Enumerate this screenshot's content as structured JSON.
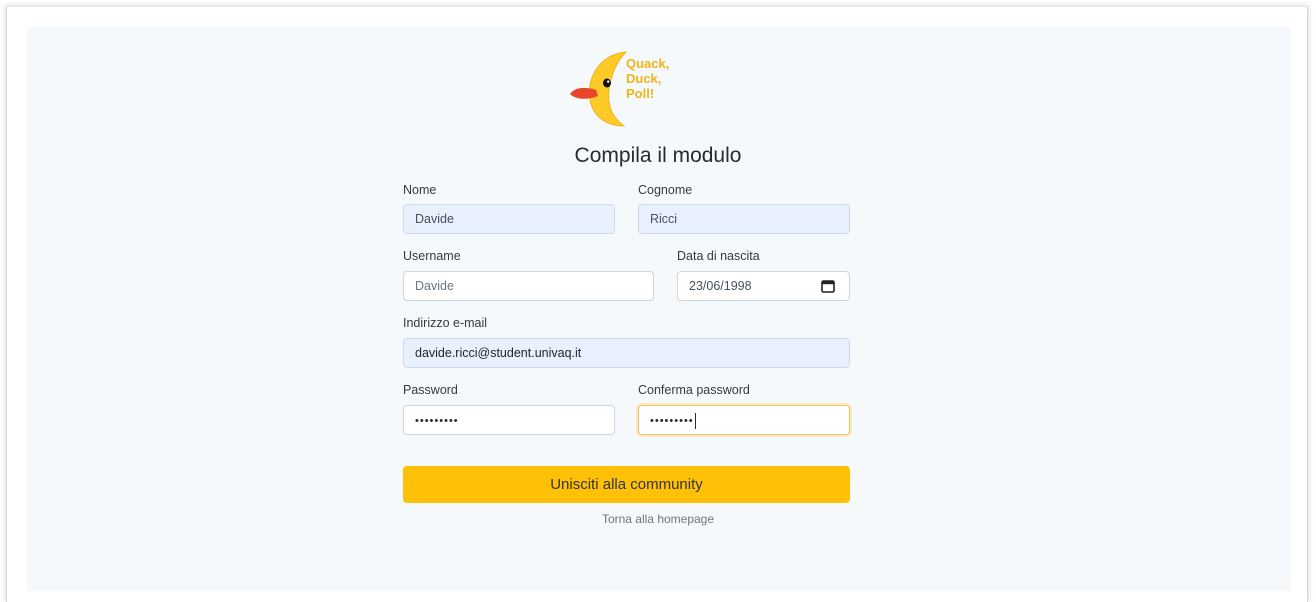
{
  "logo": {
    "line1": "Quack,",
    "line2": "Duck,",
    "line3": "Poll!",
    "colors": {
      "text": "#f0b419",
      "duck_body": "#ffc928",
      "beak": "#e8452c"
    }
  },
  "form": {
    "title": "Compila il modulo",
    "nome": {
      "label": "Nome",
      "value": "Davide"
    },
    "cognome": {
      "label": "Cognome",
      "value": "Ricci"
    },
    "username": {
      "label": "Username",
      "value": "Davide"
    },
    "data_nascita": {
      "label": "Data di nascita",
      "value": "23/06/1998"
    },
    "email": {
      "label": "Indirizzo e-mail",
      "value": "davide.ricci@student.univaq.it"
    },
    "password": {
      "label": "Password",
      "value": "•••••••••"
    },
    "conferma_password": {
      "label": "Conferma password",
      "value": "•••••••••"
    },
    "submit_label": "Unisciti alla community",
    "back_link": "Torna alla homepage"
  },
  "colors": {
    "accent": "#ffc107",
    "panel_bg": "#f6f9fc",
    "autofill_bg": "#e8f0fe"
  },
  "icons": {
    "date_picker": "calendar-icon"
  }
}
